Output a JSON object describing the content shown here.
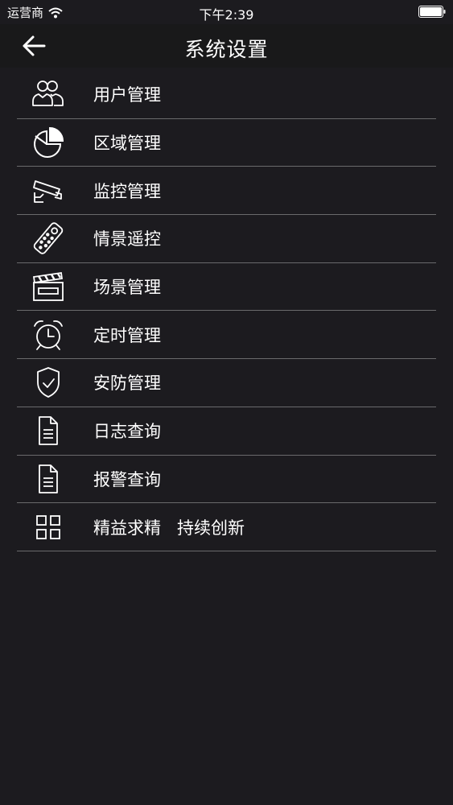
{
  "status_bar": {
    "carrier": "运营商",
    "time": "下午2:39"
  },
  "nav": {
    "title": "系统设置",
    "back_icon": "arrow-left-icon"
  },
  "menu": {
    "items": [
      {
        "label": "用户管理",
        "icon": "users-icon"
      },
      {
        "label": "区域管理",
        "icon": "pie-chart-icon"
      },
      {
        "label": "监控管理",
        "icon": "security-camera-icon"
      },
      {
        "label": "情景遥控",
        "icon": "remote-control-icon"
      },
      {
        "label": "场景管理",
        "icon": "clapperboard-icon"
      },
      {
        "label": "定时管理",
        "icon": "alarm-clock-icon"
      },
      {
        "label": "安防管理",
        "icon": "shield-check-icon"
      },
      {
        "label": "日志查询",
        "icon": "document-icon"
      },
      {
        "label": "报警查询",
        "icon": "document-icon"
      },
      {
        "label": "精益求精   持续创新",
        "icon": "grid-icon"
      }
    ]
  },
  "colors": {
    "background": "#1c1b1f",
    "nav_background": "#19191a",
    "divider": "#6a6a6c",
    "text": "#ffffff"
  }
}
